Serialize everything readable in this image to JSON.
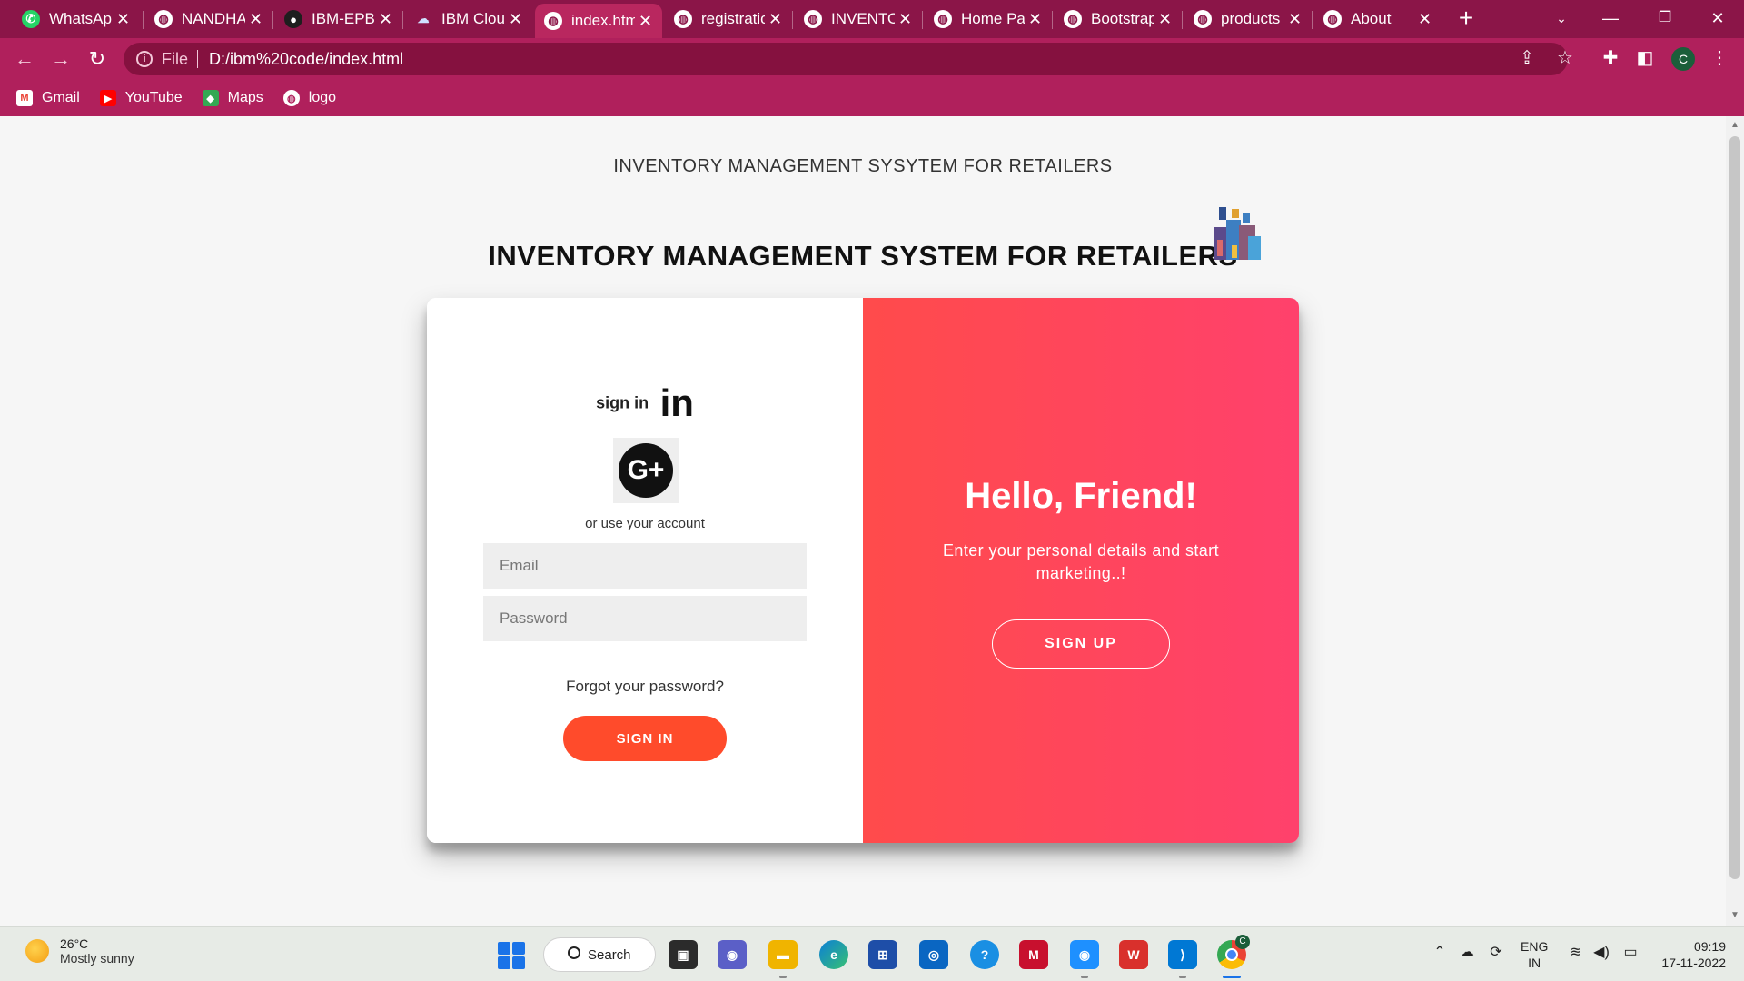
{
  "browser": {
    "tabs": [
      {
        "title": "WhatsApp",
        "icon": "whatsapp-icon",
        "active": false
      },
      {
        "title": "NANDHA",
        "icon": "globe-icon",
        "active": false
      },
      {
        "title": "IBM-EPBL",
        "icon": "github-icon",
        "active": false
      },
      {
        "title": "IBM Cloud",
        "icon": "ibm-cloud-icon",
        "active": false
      },
      {
        "title": "index.html",
        "icon": "globe-icon",
        "active": true
      },
      {
        "title": "registration",
        "icon": "globe-icon",
        "active": false
      },
      {
        "title": "INVENTORY",
        "icon": "globe-icon",
        "active": false
      },
      {
        "title": "Home Page",
        "icon": "globe-icon",
        "active": false
      },
      {
        "title": "Bootstrap",
        "icon": "globe-icon",
        "active": false
      },
      {
        "title": "products",
        "icon": "globe-icon",
        "active": false
      },
      {
        "title": "About",
        "icon": "globe-icon",
        "active": false
      }
    ],
    "address": {
      "scheme_label": "File",
      "url": "D:/ibm%20code/index.html"
    },
    "profile_initial": "C",
    "bookmarks": [
      {
        "label": "Gmail",
        "icon": "gmail-icon"
      },
      {
        "label": "YouTube",
        "icon": "youtube-icon"
      },
      {
        "label": "Maps",
        "icon": "maps-icon"
      },
      {
        "label": "logo",
        "icon": "globe-icon"
      }
    ],
    "colors": {
      "frame": "#8b1548",
      "toolbar": "#b0205c",
      "active_tab": "#b9275f"
    }
  },
  "page": {
    "title": "INVENTORY MANAGEMENT SYSYTEM FOR RETAILERS",
    "heading": "INVENTORY MANAGEMENT SYSTEM FOR RETAILERS",
    "sign_in": {
      "label": "sign in",
      "linkedin_glyph": "in",
      "google_glyph": "G+",
      "alt_text": "or use your account",
      "email_placeholder": "Email",
      "password_placeholder": "Password",
      "forgot": "Forgot your password?",
      "button": "SIGN IN"
    },
    "overlay": {
      "heading": "Hello, Friend!",
      "text": "Enter your personal details and start marketing..!",
      "button": "SIGN UP"
    },
    "colors": {
      "accent": "#ff4b2b",
      "overlay_start": "#ff4b4b",
      "overlay_end": "#ff416c"
    }
  },
  "taskbar": {
    "weather": {
      "temp": "26°C",
      "condition": "Mostly sunny"
    },
    "search_label": "Search",
    "lang_top": "ENG",
    "lang_bottom": "IN",
    "time": "09:19",
    "date": "17-11-2022",
    "chrome_badge": "C"
  }
}
